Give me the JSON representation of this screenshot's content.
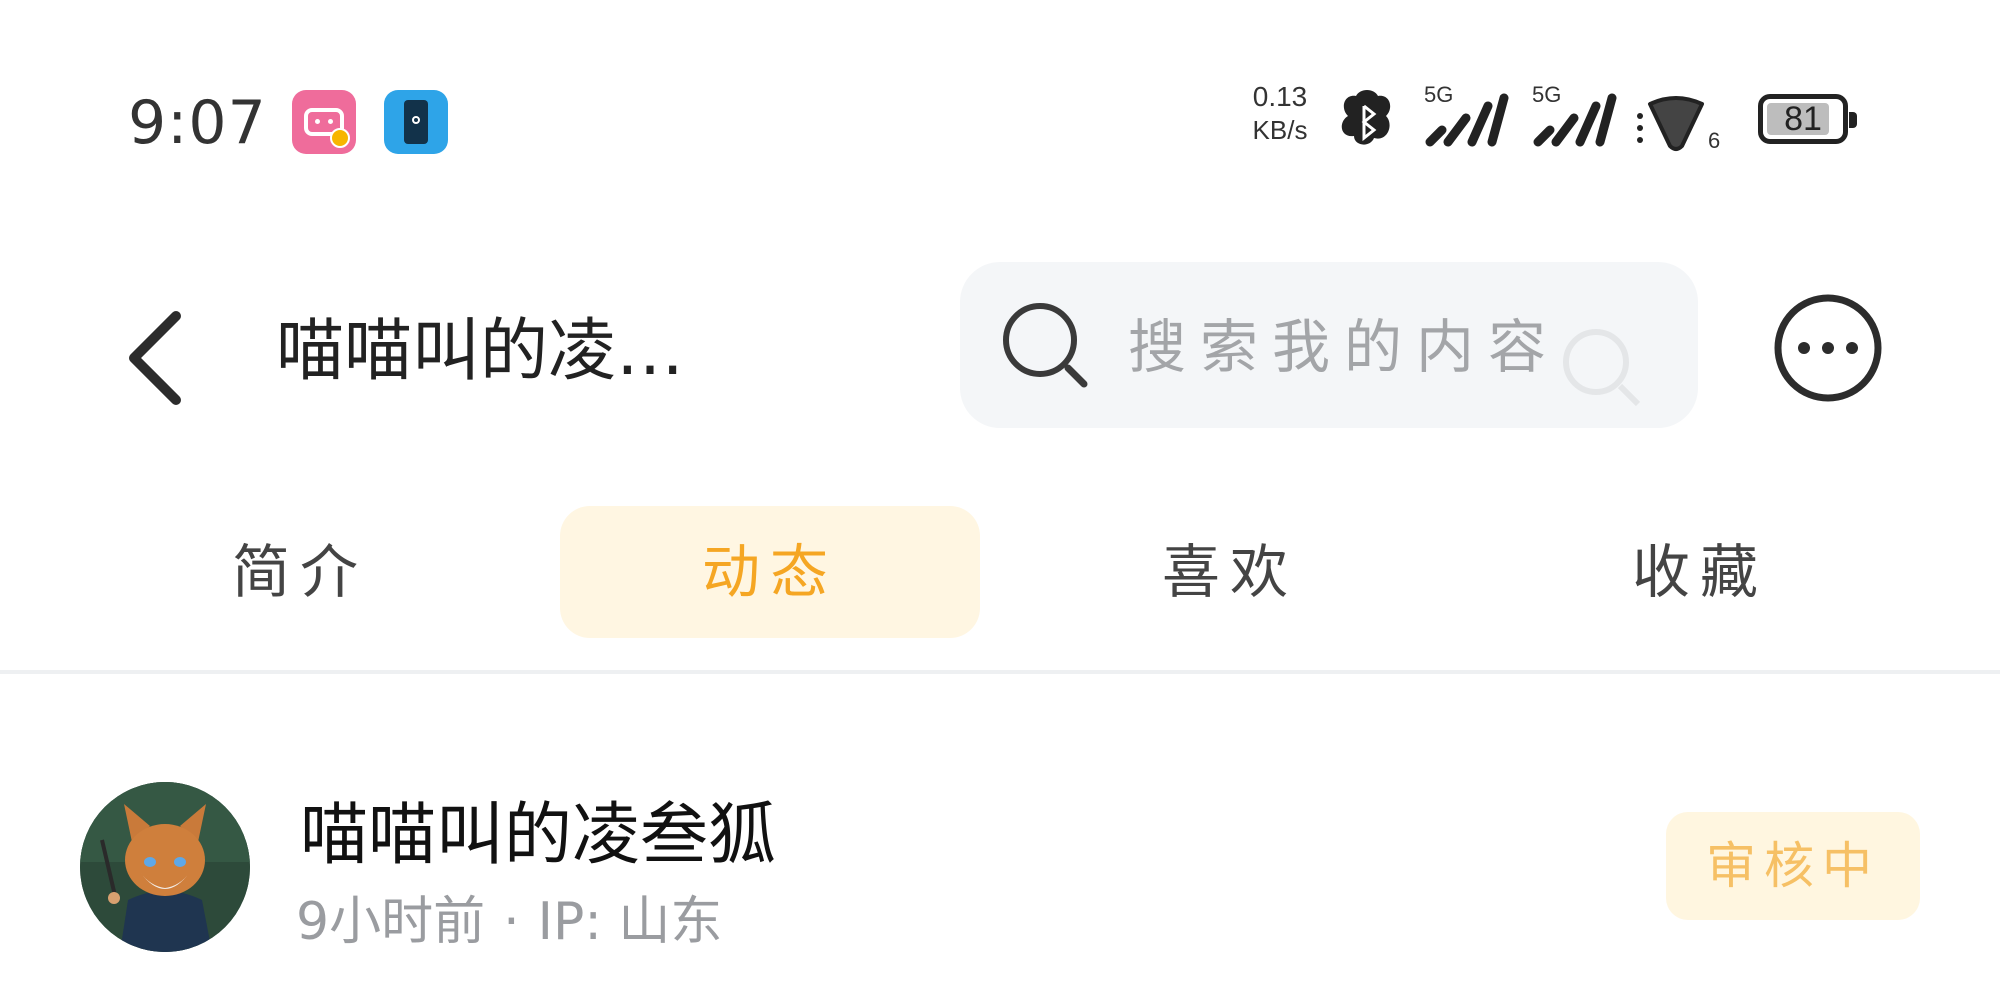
{
  "status_bar": {
    "time": "9:07",
    "net_speed_value": "0.13",
    "net_speed_unit": "KB/s",
    "sim1_label": "5G",
    "sim2_label": "5G",
    "wifi_number": "6",
    "battery_level": "81",
    "app_icons": [
      "bilibili-icon",
      "phone-app-icon"
    ]
  },
  "header": {
    "title": "喵喵叫的凌…",
    "search_placeholder": "搜索我的内容",
    "back_icon": "chevron-left-icon",
    "more_icon": "more-horizontal-icon"
  },
  "tabs": [
    {
      "label": "简介",
      "active": false
    },
    {
      "label": "动态",
      "active": true
    },
    {
      "label": "喜欢",
      "active": false
    },
    {
      "label": "收藏",
      "active": false
    }
  ],
  "post": {
    "author": "喵喵叫的凌叁狐",
    "time_ago": "9小时前",
    "separator": "·",
    "ip_location": "IP: 山东",
    "status": "审核中"
  },
  "colors": {
    "accent": "#f5a623",
    "tab_active_bg": "#fff6e2",
    "badge_bg": "#fff6e0",
    "badge_text": "#f6c065",
    "search_bg": "#f4f6f8"
  }
}
